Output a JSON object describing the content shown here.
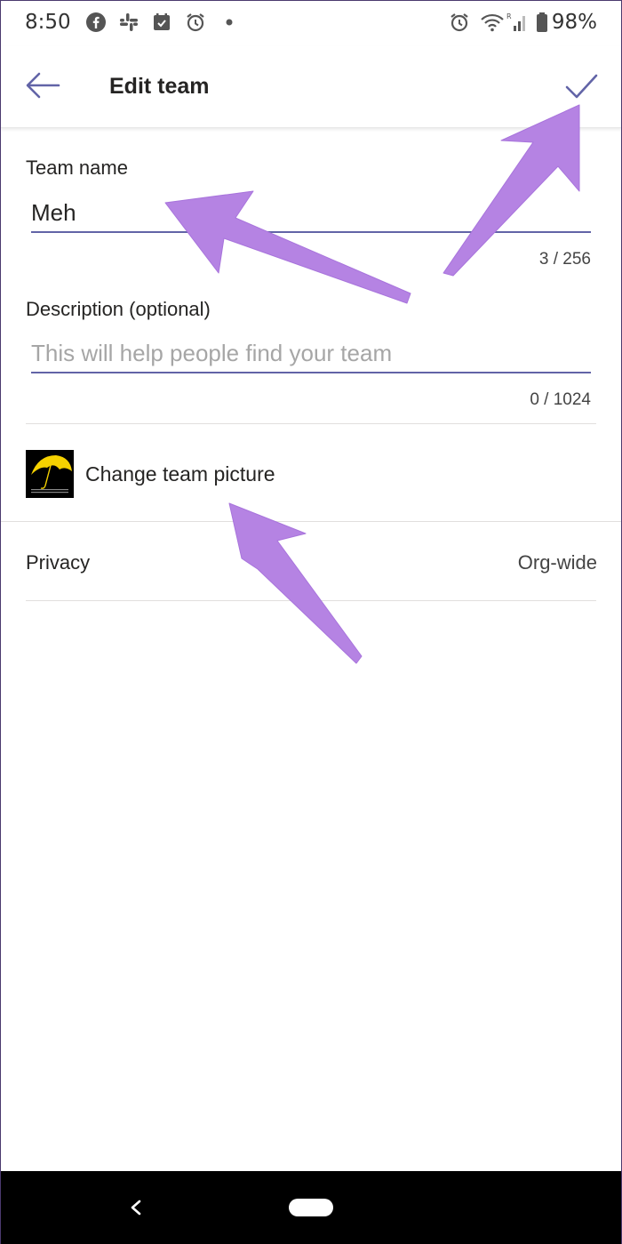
{
  "status_bar": {
    "time": "8:50",
    "battery": "98%",
    "icons": [
      "facebook-icon",
      "slack-icon",
      "calendar-icon",
      "alarm-icon",
      "dot-icon",
      "alarm-icon",
      "wifi-icon",
      "signal-icon",
      "battery-icon"
    ]
  },
  "app_bar": {
    "title": "Edit team",
    "back_icon": "arrow-left-icon",
    "save_icon": "checkmark-icon"
  },
  "team_name": {
    "label": "Team name",
    "value": "Meh",
    "counter": "3 / 256"
  },
  "description": {
    "label": "Description (optional)",
    "placeholder": "This will help people find your team",
    "counter": "0 / 1024"
  },
  "team_picture": {
    "label": "Change team picture"
  },
  "privacy": {
    "label": "Privacy",
    "value": "Org-wide"
  },
  "colors": {
    "accent": "#6264a7",
    "annotation_arrow": "#b583e3"
  }
}
